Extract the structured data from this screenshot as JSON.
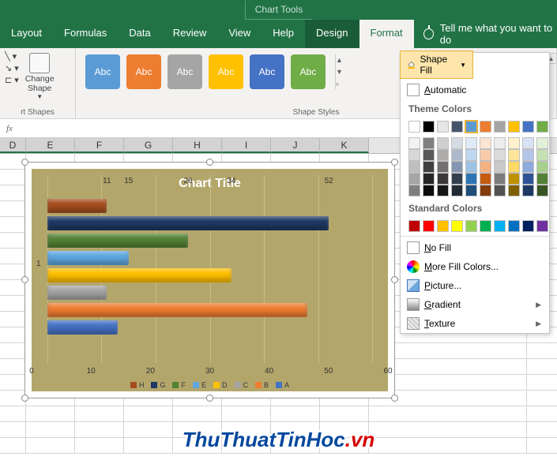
{
  "titlebar": {
    "text": "Chart Tools"
  },
  "tabs": {
    "layout": "Layout",
    "formulas": "Formulas",
    "data": "Data",
    "review": "Review",
    "view": "View",
    "help": "Help",
    "design": "Design",
    "format": "Format",
    "tellme": "Tell me what you want to do"
  },
  "ribbon": {
    "group_shapes": "rt Shapes",
    "change_shape": "Change\nShape",
    "group_styles": "Shape Styles",
    "style_label": "Abc",
    "style_colors": [
      "#5b9bd5",
      "#ed7d31",
      "#a5a5a5",
      "#ffc000",
      "#4472c4",
      "#70ad47"
    ]
  },
  "dropdown": {
    "button": "Shape Fill",
    "automatic": "Automatic",
    "theme_colors": "Theme Colors",
    "standard_colors": "Standard Colors",
    "no_fill": "No Fill",
    "more_colors": "More Fill Colors...",
    "picture": "Picture...",
    "gradient": "Gradient",
    "texture": "Texture",
    "theme_row1": [
      "#ffffff",
      "#000000",
      "#e7e6e6",
      "#44546a",
      "#5b9bd5",
      "#ed7d31",
      "#a5a5a5",
      "#ffc000",
      "#4472c4",
      "#70ad47"
    ],
    "theme_shades": [
      [
        "#f2f2f2",
        "#7f7f7f",
        "#d0cece",
        "#d6dce4",
        "#deebf6",
        "#fbe5d5",
        "#ededed",
        "#fff2cc",
        "#d9e2f3",
        "#e2efd9"
      ],
      [
        "#d8d8d8",
        "#595959",
        "#aeabab",
        "#adb9ca",
        "#bdd7ee",
        "#f7cbac",
        "#dbdbdb",
        "#fee599",
        "#b4c6e7",
        "#c5e0b3"
      ],
      [
        "#bfbfbf",
        "#3f3f3f",
        "#757070",
        "#8496b0",
        "#9cc3e5",
        "#f4b183",
        "#c9c9c9",
        "#ffd965",
        "#8eaadb",
        "#a8d08d"
      ],
      [
        "#a5a5a5",
        "#262626",
        "#3a3838",
        "#323f4f",
        "#2e75b5",
        "#c55a11",
        "#7b7b7b",
        "#bf9000",
        "#2f5496",
        "#538135"
      ],
      [
        "#7f7f7f",
        "#0c0c0c",
        "#171616",
        "#222a35",
        "#1e4e79",
        "#833c0b",
        "#525252",
        "#7f6000",
        "#1f3864",
        "#375623"
      ]
    ],
    "standard_row": [
      "#c00000",
      "#ff0000",
      "#ffc000",
      "#ffff00",
      "#92d050",
      "#00b050",
      "#00b0f0",
      "#0070c0",
      "#002060",
      "#7030a0"
    ]
  },
  "columns": [
    "D",
    "E",
    "F",
    "G",
    "H",
    "I",
    "J",
    "K"
  ],
  "chart_data": {
    "type": "bar",
    "title": "Chart Title",
    "xlabel": "",
    "ylabel": "",
    "xlim": [
      0,
      60
    ],
    "xticks": [
      0,
      10,
      20,
      30,
      40,
      50,
      60
    ],
    "categories": [
      "1"
    ],
    "series": [
      {
        "name": "H",
        "color": "#a64d1e",
        "values": [
          11
        ]
      },
      {
        "name": "G",
        "color": "#1f3864",
        "values": [
          52
        ]
      },
      {
        "name": "F",
        "color": "#548235",
        "values": [
          26
        ]
      },
      {
        "name": "E",
        "color": "#5ea7e0",
        "values": [
          15
        ]
      },
      {
        "name": "D",
        "color": "#ffc000",
        "values": [
          34
        ]
      },
      {
        "name": "C",
        "color": "#a5a5a5",
        "values": [
          11
        ]
      },
      {
        "name": "B",
        "color": "#ed7d31",
        "values": [
          48
        ]
      },
      {
        "name": "A",
        "color": "#4472c4",
        "values": [
          13
        ]
      }
    ],
    "data_labels_top": [
      {
        "x": 34,
        "v": "34",
        "s": "A"
      },
      {
        "x": 15,
        "v": "15",
        "s": "E"
      },
      {
        "x": 26,
        "v": "26",
        "s": "F"
      },
      {
        "x": 52,
        "v": "52",
        "s": "G"
      },
      {
        "x": 11,
        "v": "11",
        "s": "H"
      }
    ]
  },
  "watermark": {
    "a": "ThuThuatTinHoc",
    "b": ".vn"
  },
  "fx_label": "fx"
}
